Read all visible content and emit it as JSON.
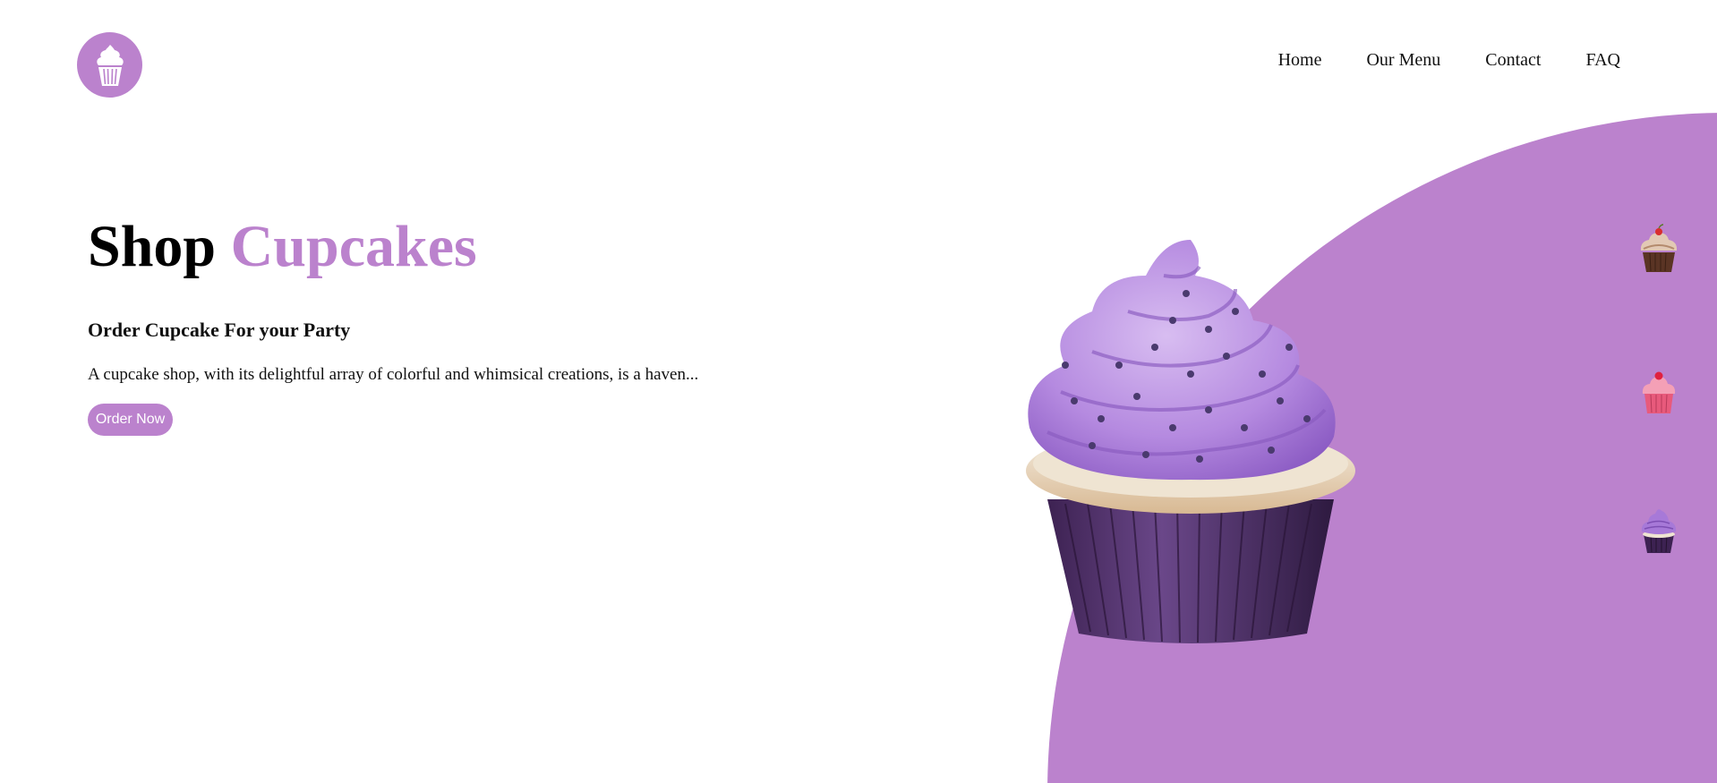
{
  "colors": {
    "accent": "#bb82cd",
    "frosting_light": "#c9a4e6",
    "frosting_dark": "#9b6bd1",
    "liner": "#4d2c68",
    "cake": "#f1e6d6",
    "pink": "#e85a7c",
    "chocolate": "#5a3424"
  },
  "header": {
    "logo_icon": "cupcake-icon",
    "nav": [
      {
        "label": "Home"
      },
      {
        "label": "Our Menu"
      },
      {
        "label": "Contact"
      },
      {
        "label": "FAQ"
      }
    ]
  },
  "hero": {
    "title_part1": "Shop",
    "title_part2": "Cupcakes",
    "subtitle": "Order Cupcake For your Party",
    "description": "A cupcake shop, with its delightful array of colorful and whimsical creations, is a haven...",
    "cta_label": "Order Now"
  },
  "gallery": {
    "featured": "purple-cupcake",
    "thumbnails": [
      {
        "name": "chocolate-cupcake"
      },
      {
        "name": "pink-cupcake"
      },
      {
        "name": "purple-cupcake"
      }
    ]
  }
}
